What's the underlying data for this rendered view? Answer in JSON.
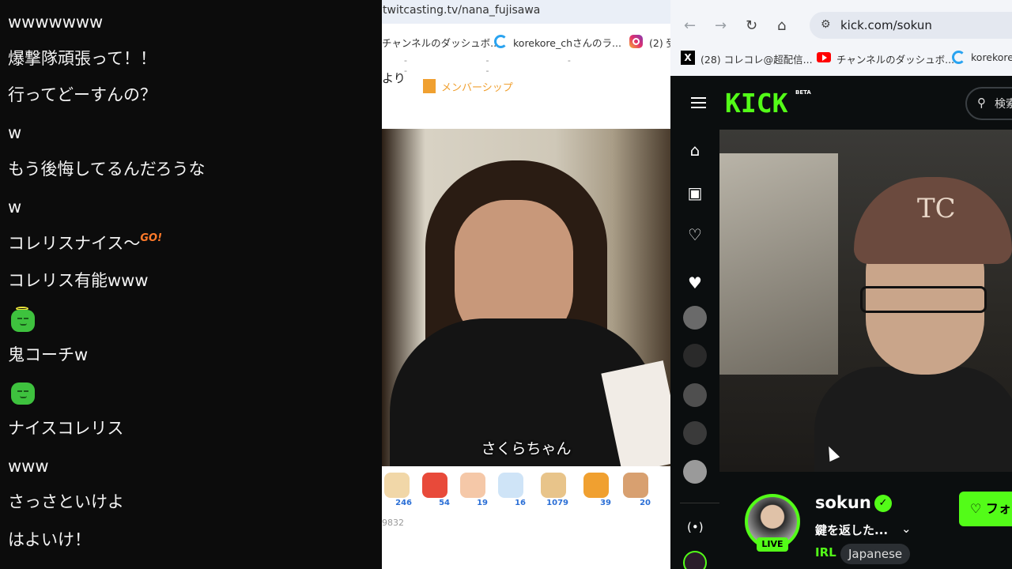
{
  "chat": {
    "messages": [
      "wwwwwww",
      "爆撃隊頑張って！！",
      "行ってどーすんの？",
      "w",
      "もう後悔してるんだろうな",
      "w",
      "コレリスナイス〜",
      "コレリス有能www",
      "鬼コーチw",
      "ナイスコレリス",
      "www",
      "さっさといけよ",
      "はよいけ！"
    ],
    "sticker_text": "GO!"
  },
  "twitcasting": {
    "url": "twitcasting.tv/nana_fujisawa",
    "bookmarks": [
      "チャンネルのダッシュボ...",
      "korekore_chさんのラ...",
      "(2) 受"
    ],
    "partial_text": "より",
    "membership_label": "メンバーシップ",
    "subtitle": "さくらちゃん",
    "gift_counts": [
      "246",
      "54",
      "19",
      "16",
      "1079",
      "39",
      "20"
    ],
    "view_count": "9832"
  },
  "kick": {
    "url": "kick.com/sokun",
    "bookmarks": [
      "(28) コレコレ@超配信...",
      "チャンネルのダッシュボ...",
      "korekore"
    ],
    "logo_text": "KICK",
    "beta_label": "BETA",
    "search_placeholder": "検索",
    "streamer_name": "sokun",
    "live_label": "LIVE",
    "stream_title": "鍵を返した...",
    "category": "IRL",
    "language": "Japanese",
    "follow_label": "フォ"
  }
}
